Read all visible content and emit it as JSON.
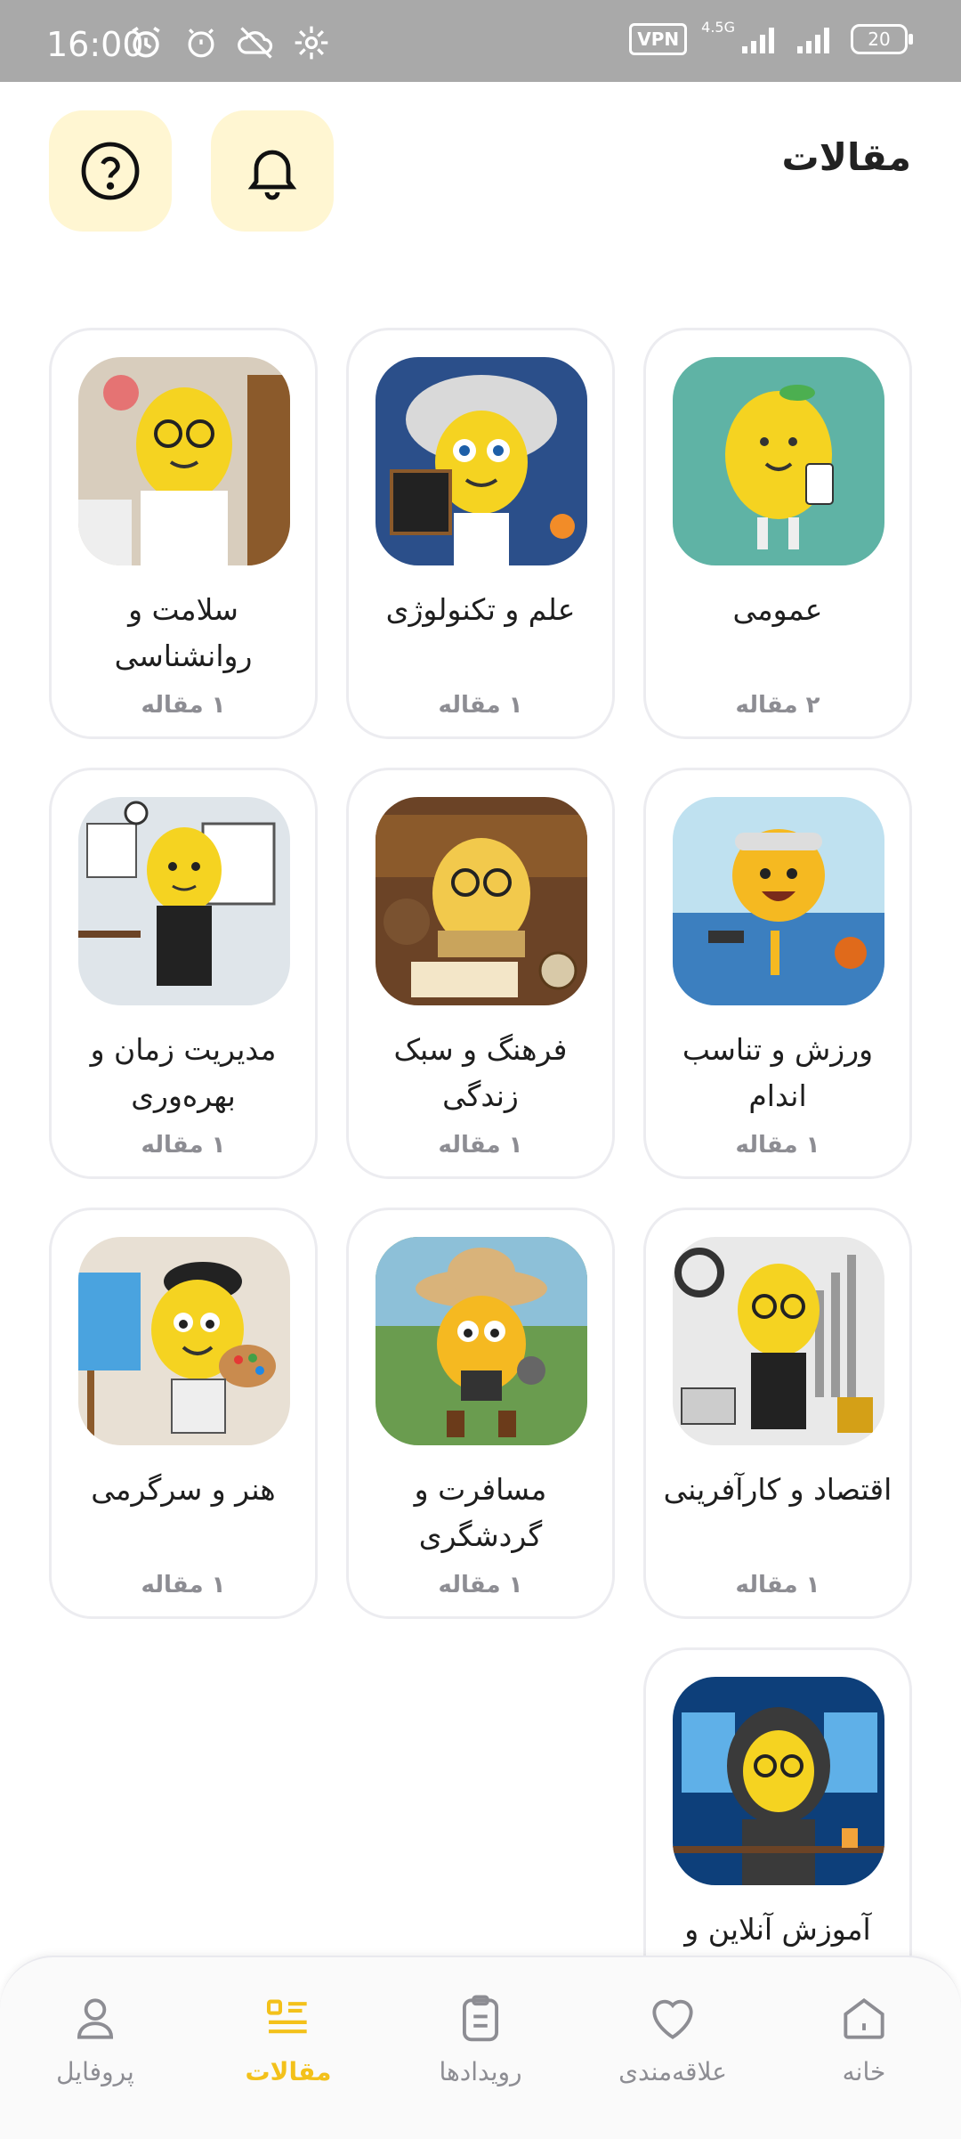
{
  "status_bar": {
    "time": "16:00",
    "vpn": "VPN",
    "network": "4.5G",
    "battery": "20"
  },
  "header": {
    "title": "مقالات"
  },
  "categories": [
    {
      "title": "عمومی",
      "count": "۲ مقاله",
      "image": "lemon-with-tablet"
    },
    {
      "title": "علم و تکنولوژی",
      "count": "۱ مقاله",
      "image": "lemon-scientist"
    },
    {
      "title": "سلامت و روانشناسی",
      "count": "۱ مقاله",
      "image": "lemon-doctor"
    },
    {
      "title": "ورزش و تناسب اندام",
      "count": "۱ مقاله",
      "image": "lemon-athlete"
    },
    {
      "title": "فرهنگ و سبک زندگی",
      "count": "۱ مقاله",
      "image": "lemon-reader"
    },
    {
      "title": "مدیریت زمان و بهره‌وری",
      "count": "۱ مقاله",
      "image": "lemon-manager"
    },
    {
      "title": "اقتصاد و کارآفرینی",
      "count": "۱ مقاله",
      "image": "lemon-economist"
    },
    {
      "title": "مسافرت و گردشگری",
      "count": "۱ مقاله",
      "image": "lemon-explorer"
    },
    {
      "title": "هنر و سرگرمی",
      "count": "۱ مقاله",
      "image": "lemon-painter"
    },
    {
      "title": "آموزش آنلاین و",
      "count": "",
      "image": "lemon-hacker"
    }
  ],
  "bottom_nav": [
    {
      "label": "خانه",
      "icon": "home-icon"
    },
    {
      "label": "علاقه‌مندی",
      "icon": "heart-icon"
    },
    {
      "label": "رویدادها",
      "icon": "clipboard-icon"
    },
    {
      "label": "مقالات",
      "icon": "list-icon",
      "active": true
    },
    {
      "label": "پروفایل",
      "icon": "user-icon"
    }
  ],
  "colors": {
    "accent": "#f3c11a",
    "header_button_bg": "#fff6d2",
    "status_bar": "#a9a9a9",
    "muted_text": "#8d8d93"
  }
}
